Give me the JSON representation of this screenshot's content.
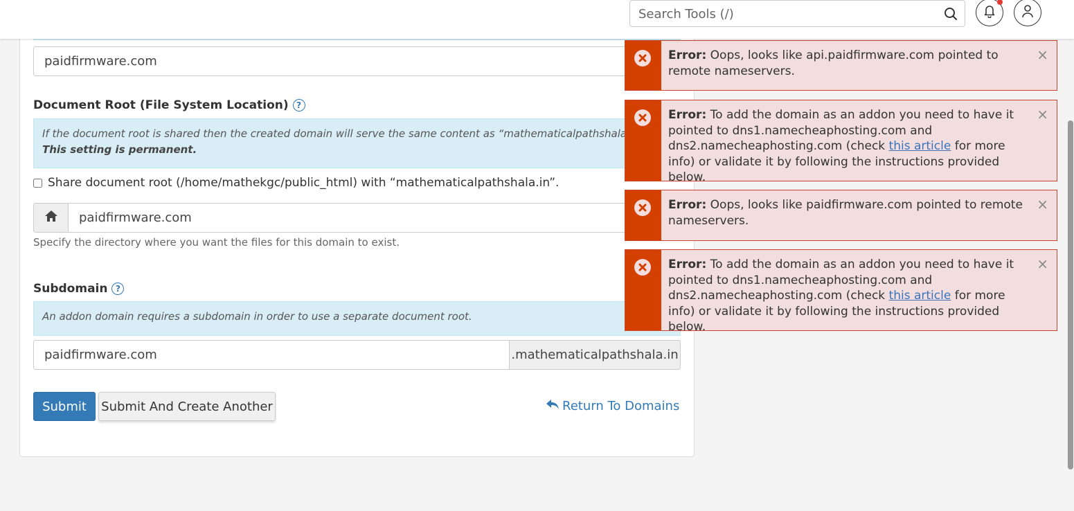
{
  "header": {
    "search_placeholder": "Search Tools (/)"
  },
  "form": {
    "domain_value": "paidfirmware.com",
    "docroot": {
      "label": "Document Root (File System Location)",
      "info_text": "If the document root is shared then the created domain will serve the same content as “mathematicalpathshala.in”.",
      "info_strong": "This setting is permanent.",
      "share_checkbox_label": "Share document root (/home/mathekgc/public_html) with “mathematicalpathshala.in”.",
      "value": "paidfirmware.com",
      "hint": "Specify the directory where you want the files for this domain to exist."
    },
    "subdomain": {
      "label": "Subdomain",
      "info_text": "An addon domain requires a subdomain in order to use a separate document root.",
      "value": "paidfirmware.com",
      "suffix": ".mathematicalpathshala.in"
    },
    "submit_label": "Submit",
    "submit_another_label": "Submit And Create Another",
    "return_label": "Return To Domains"
  },
  "alerts": [
    {
      "prefix": "Error:",
      "text": "Oops, looks like api.paidfirmware.com pointed to remote nameservers."
    },
    {
      "prefix": "Error:",
      "text_before": "To add the domain as an addon you need to have it pointed to dns1.namecheaphosting.com and dns2.namecheaphosting.com (check",
      "link": "this article",
      "text_after": "for more info) or validate it by following the instructions provided below."
    },
    {
      "prefix": "Error:",
      "text": "Oops, looks like paidfirmware.com pointed to remote nameservers."
    },
    {
      "prefix": "Error:",
      "text_before": "To add the domain as an addon you need to have it pointed to dns1.namecheaphosting.com and dns2.namecheaphosting.com (check",
      "link": "this article",
      "text_after": "for more info) or validate it by following the instructions provided below."
    }
  ],
  "icons": {
    "close_glyph": "×",
    "help_glyph": "?"
  },
  "colors": {
    "primary": "#337ab7",
    "error_side": "#d44000",
    "error_bg": "#f2dede",
    "info_bg": "#d9edf7"
  }
}
